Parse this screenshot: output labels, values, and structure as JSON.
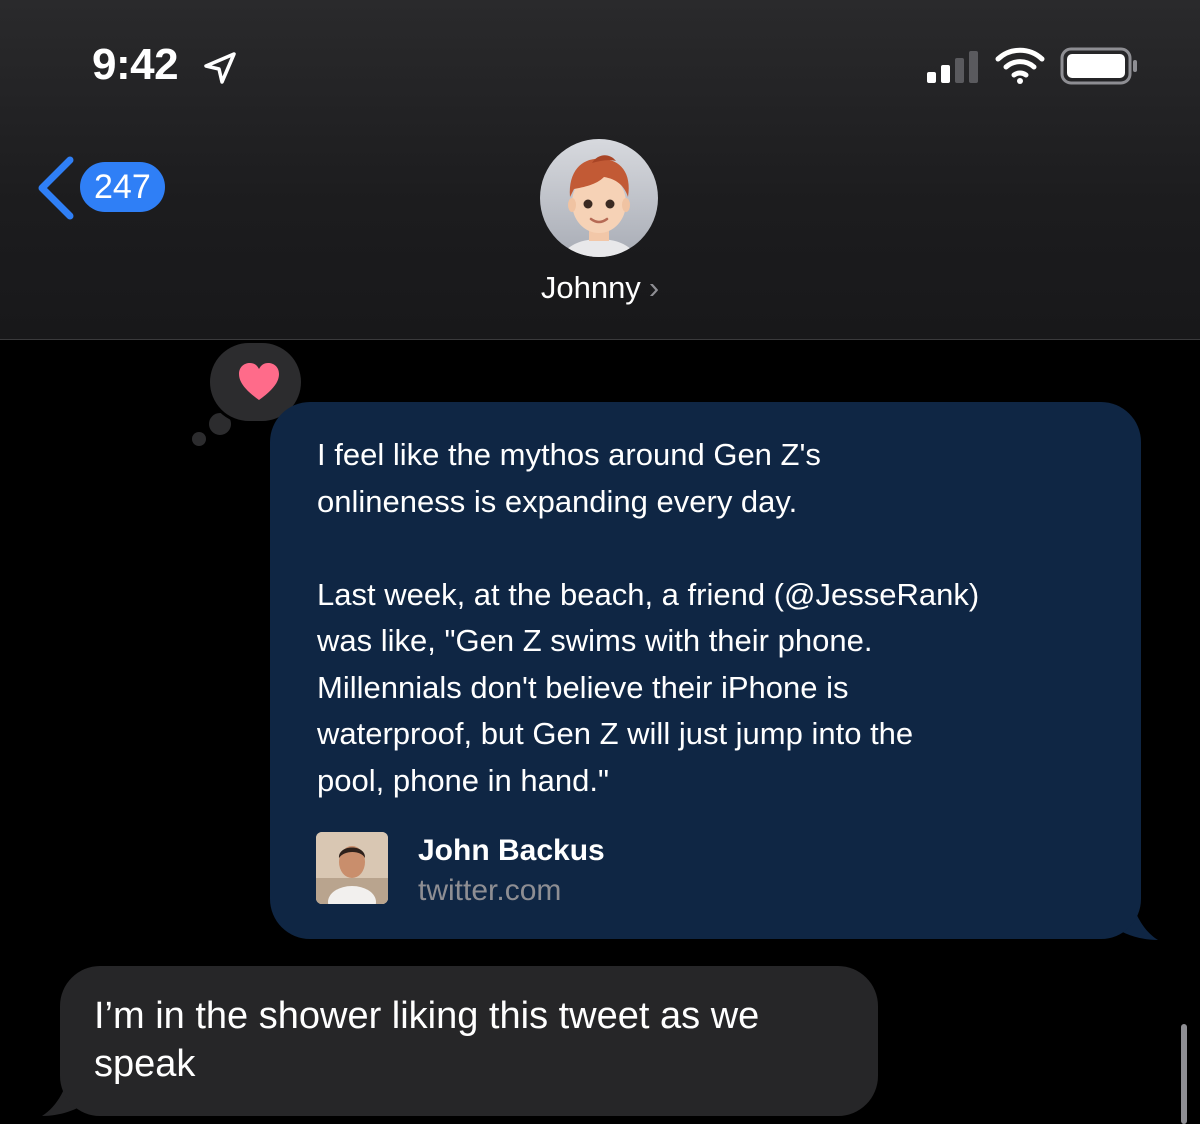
{
  "status_bar": {
    "time": "9:42",
    "location_icon": "location-arrow-icon",
    "signal_icon": "cellular-signal-icon",
    "wifi_icon": "wifi-icon",
    "battery_icon": "battery-icon"
  },
  "nav": {
    "unread_count": "247",
    "contact_name": "Johnny",
    "chevron": "›"
  },
  "messages": {
    "link_preview": {
      "reaction": "heart",
      "text": "I feel like the mythos around Gen Z's\nonlineness is expanding every day.\n\nLast week, at the beach, a friend (@JesseRank)\nwas like, \"Gen Z swims with their phone.\nMillennials don't believe their iPhone is\nwaterproof, but Gen Z will just jump into the\npool, phone in hand.\"",
      "author": "John Backus",
      "domain": "twitter.com"
    },
    "reply": {
      "text": "I’m in the shower liking this tweet as we speak"
    }
  },
  "colors": {
    "accent_blue": "#2f7ff6",
    "link_bubble": "#0f2644",
    "incoming_bubble": "#262628",
    "heart": "#ff6b8a"
  }
}
